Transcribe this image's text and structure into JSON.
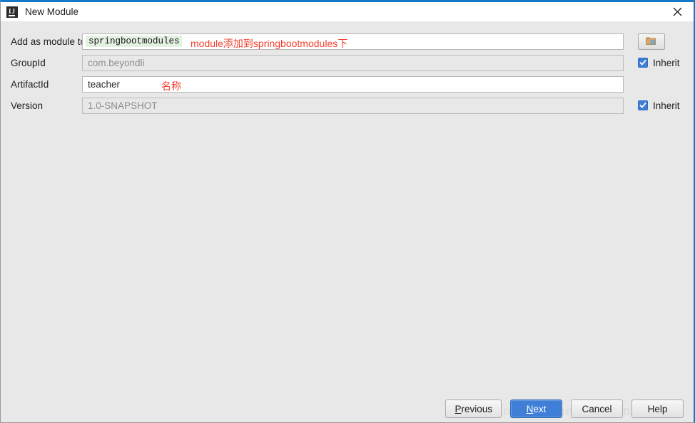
{
  "window": {
    "title": "New Module",
    "app_icon": "intellij-idea-icon",
    "close_icon": "close-icon",
    "accent_color": "#1479c8",
    "background_color": "#e8e8e8"
  },
  "form": {
    "rows": [
      {
        "label": "Add as module to",
        "value": "springbootmodules",
        "style": "mono-highlight",
        "disabled": false,
        "annotation": "module添加到springbootmodules下",
        "annotation_color": "#f4402f",
        "control": "browse-button"
      },
      {
        "label": "GroupId",
        "value": "com.beyondli",
        "style": "muted",
        "disabled": true,
        "annotation": "",
        "control": "inherit-checkbox"
      },
      {
        "label": "ArtifactId",
        "value": "teacher",
        "style": "normal",
        "disabled": false,
        "annotation": "名称",
        "annotation_color": "#f4402f",
        "control": "none"
      },
      {
        "label": "Version",
        "value": "1.0-SNAPSHOT",
        "style": "muted",
        "disabled": true,
        "annotation": "",
        "control": "inherit-checkbox"
      }
    ],
    "inherit_label": "Inherit",
    "inherit_checked": true,
    "browse_icon": "folder-icon"
  },
  "footer": {
    "buttons": [
      {
        "label": "Previous",
        "mnemonic": "P",
        "primary": false
      },
      {
        "label": "Next",
        "mnemonic": "N",
        "primary": true
      },
      {
        "label": "Cancel",
        "mnemonic": "",
        "primary": false
      },
      {
        "label": "Help",
        "mnemonic": "",
        "primary": false
      }
    ],
    "watermark": "http://blog.csdn.net/liboyang71"
  }
}
